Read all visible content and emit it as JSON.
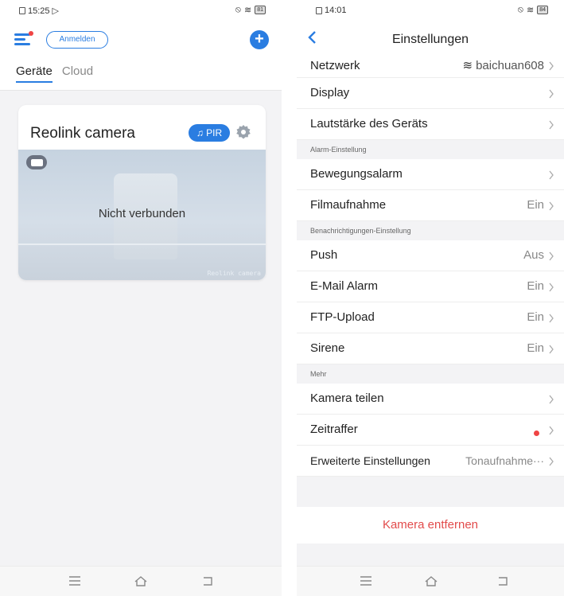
{
  "left": {
    "status": {
      "time": "15:25",
      "battery": "81"
    },
    "header": {
      "login_label": "Anmelden",
      "add_icon": "plus-circle-icon",
      "menu_icon": "menu-icon"
    },
    "tabs": [
      {
        "label": "Geräte",
        "active": true
      },
      {
        "label": "Cloud",
        "active": false
      }
    ],
    "camera_card": {
      "name": "Reolink camera",
      "badge": "PIR",
      "status_message": "Nicht verbunden",
      "watermark": "Reolink camera"
    }
  },
  "right": {
    "status": {
      "time": "14:01",
      "battery": "84"
    },
    "header": {
      "title": "Einstellungen",
      "back_icon": "back-chevron-icon"
    },
    "rows_top": [
      {
        "label": "Netzwerk",
        "value": "baichuan608",
        "icon": "wifi-icon"
      },
      {
        "label": "Display",
        "value": ""
      },
      {
        "label": "Lautstärke des Geräts",
        "value": ""
      }
    ],
    "section_alarm": "Alarm-Einstellung",
    "rows_alarm": [
      {
        "label": "Bewegungsalarm",
        "value": ""
      },
      {
        "label": "Filmaufnahme",
        "value": "Ein"
      }
    ],
    "section_notify": "Benachrichtigungen-Einstellung",
    "rows_notify": [
      {
        "label": "Push",
        "value": "Aus"
      },
      {
        "label": "E-Mail Alarm",
        "value": "Ein"
      },
      {
        "label": "FTP-Upload",
        "value": "Ein"
      },
      {
        "label": "Sirene",
        "value": "Ein"
      }
    ],
    "section_more": "Mehr",
    "rows_more": [
      {
        "label": "Kamera teilen",
        "value": ""
      },
      {
        "label": "Zeitraffer",
        "value": ""
      },
      {
        "label": "Erweiterte Einstellungen",
        "value": "Tonaufnahme···"
      }
    ],
    "remove_label": "Kamera entfernen",
    "accent_color": "#2a7de1",
    "danger_color": "#e24b4b"
  },
  "navbar": {
    "icons": [
      "home-menu-icon",
      "home-icon",
      "back-icon"
    ]
  }
}
